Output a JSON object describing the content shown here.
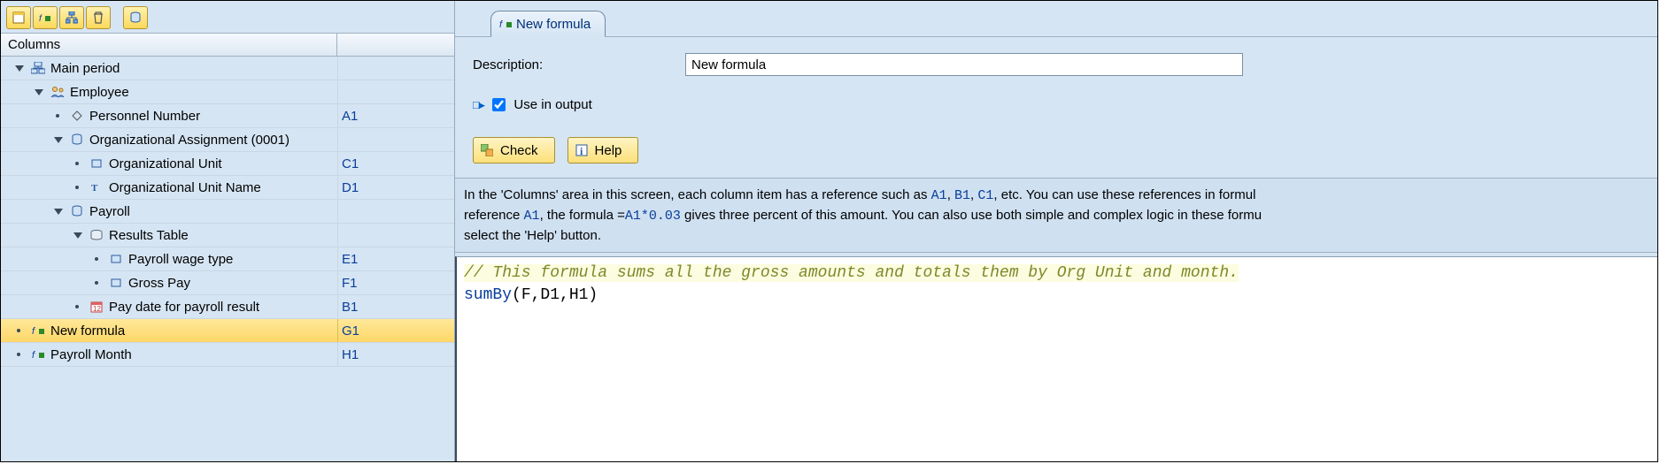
{
  "left": {
    "header": "Columns",
    "tree": [
      {
        "indent": 0,
        "expander": "caret",
        "icon": "period",
        "text": "Main period",
        "ref": "",
        "selected": false,
        "name": "tree-main-period"
      },
      {
        "indent": 1,
        "expander": "caret",
        "icon": "employee",
        "text": "Employee",
        "ref": "",
        "selected": false,
        "name": "tree-employee"
      },
      {
        "indent": 2,
        "expander": "bullet",
        "icon": "diamond",
        "text": "Personnel Number",
        "ref": "A1",
        "selected": false,
        "name": "tree-personnel-number"
      },
      {
        "indent": 2,
        "expander": "caret",
        "icon": "db",
        "text": "Organizational Assignment (0001)",
        "ref": "",
        "selected": false,
        "name": "tree-org-assignment"
      },
      {
        "indent": 3,
        "expander": "bullet",
        "icon": "field",
        "text": "Organizational Unit",
        "ref": "C1",
        "selected": false,
        "name": "tree-org-unit"
      },
      {
        "indent": 3,
        "expander": "bullet",
        "icon": "textfield",
        "text": "Organizational Unit Name",
        "ref": "D1",
        "selected": false,
        "name": "tree-org-unit-name"
      },
      {
        "indent": 2,
        "expander": "caret",
        "icon": "db",
        "text": "Payroll",
        "ref": "",
        "selected": false,
        "name": "tree-payroll"
      },
      {
        "indent": 3,
        "expander": "caret",
        "icon": "table",
        "text": "Results Table",
        "ref": "",
        "selected": false,
        "name": "tree-results-table"
      },
      {
        "indent": 4,
        "expander": "bullet",
        "icon": "field",
        "text": "Payroll wage type",
        "ref": "E1",
        "selected": false,
        "name": "tree-wage-type"
      },
      {
        "indent": 4,
        "expander": "bullet",
        "icon": "field",
        "text": "Gross Pay",
        "ref": "F1",
        "selected": false,
        "name": "tree-gross-pay"
      },
      {
        "indent": 3,
        "expander": "bullet",
        "icon": "paydate",
        "text": "Pay date for payroll result",
        "ref": "B1",
        "selected": false,
        "name": "tree-pay-date"
      },
      {
        "indent": 0,
        "expander": "bullet",
        "icon": "formula",
        "text": "New formula",
        "ref": "G1",
        "selected": true,
        "name": "tree-new-formula"
      },
      {
        "indent": 0,
        "expander": "bullet",
        "icon": "formula",
        "text": "Payroll Month",
        "ref": "H1",
        "selected": false,
        "name": "tree-payroll-month"
      }
    ]
  },
  "right": {
    "tab_label": "New formula",
    "desc_label": "Description:",
    "desc_value": "New formula",
    "use_output_label": "Use in output",
    "use_output_checked": true,
    "check_btn": "Check",
    "help_btn": "Help",
    "info_p1a": "In the 'Columns' area in this screen, each column item has a reference such as ",
    "info_ref1": "A1",
    "info_c1": ", ",
    "info_ref2": "B1",
    "info_c2": ", ",
    "info_ref3": "C1",
    "info_p1b": ", etc. You can use these references in formul",
    "info_p2a": "reference ",
    "info_ref4": "A1",
    "info_p2b": ", the formula =",
    "info_ref5": "A1*0.03",
    "info_p2c": " gives three percent of this amount. You can also use both simple and complex logic in these formu",
    "info_p3": "select the 'Help' button.",
    "editor_comment": "// This formula sums all the gross amounts and totals them by Org Unit and month.",
    "editor_func": "sumBy",
    "editor_args": "(F,D1,H1)"
  }
}
